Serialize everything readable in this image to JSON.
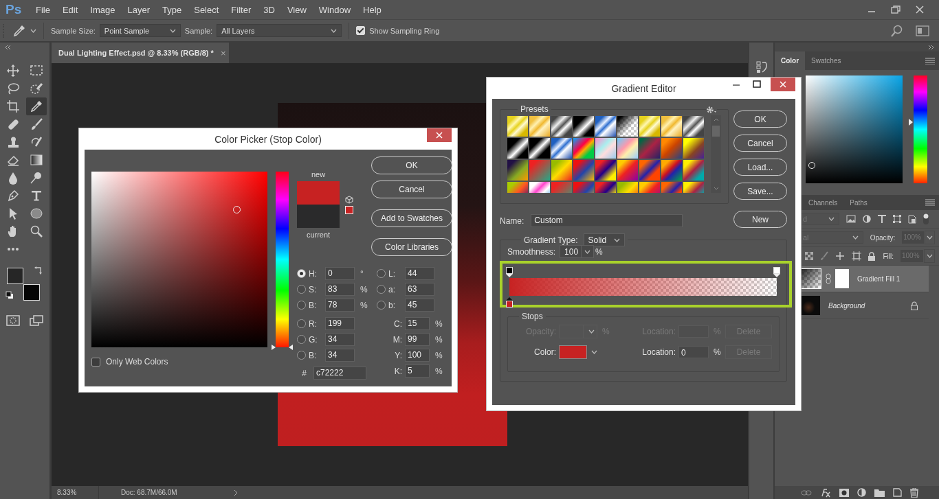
{
  "menu_bar": {
    "logo": "Ps",
    "items": [
      "File",
      "Edit",
      "Image",
      "Layer",
      "Type",
      "Select",
      "Filter",
      "3D",
      "View",
      "Window",
      "Help"
    ]
  },
  "options_bar": {
    "sample_size_label": "Sample Size:",
    "sample_size": "Point Sample",
    "sample_label": "Sample:",
    "sample": "All Layers",
    "sampling_ring": {
      "label": "Show Sampling Ring",
      "checked": true
    }
  },
  "tools": [
    {
      "kind": "move",
      "selected": false
    },
    {
      "kind": "marquee",
      "selected": false
    },
    {
      "kind": "lasso",
      "selected": false
    },
    {
      "kind": "quick-select",
      "selected": false
    },
    {
      "kind": "crop",
      "selected": false
    },
    {
      "kind": "eyedropper",
      "selected": true
    },
    {
      "kind": "healing",
      "selected": false
    },
    {
      "kind": "brush",
      "selected": false
    },
    {
      "kind": "stamp",
      "selected": false
    },
    {
      "kind": "history-brush",
      "selected": false
    },
    {
      "kind": "eraser",
      "selected": false
    },
    {
      "kind": "gradient",
      "selected": false
    },
    {
      "kind": "blur",
      "selected": false
    },
    {
      "kind": "dodge",
      "selected": false
    },
    {
      "kind": "pen",
      "selected": false
    },
    {
      "kind": "type",
      "selected": false
    },
    {
      "kind": "path-select",
      "selected": false
    },
    {
      "kind": "ellipse",
      "selected": false
    },
    {
      "kind": "hand",
      "selected": false
    },
    {
      "kind": "zoom",
      "selected": false
    },
    {
      "kind": "more",
      "selected": false
    }
  ],
  "color_swatches": [
    {
      "kind": "foreground",
      "color": "#262626"
    },
    {
      "kind": "background",
      "color": "#050505"
    }
  ],
  "view_tools": [
    {
      "kind": "quick-mask",
      "selected": false
    },
    {
      "kind": "screen-mode",
      "selected": false
    }
  ],
  "document": {
    "tab": "Dual Lighting Effect.psd @ 8.33% (RGB/8) *",
    "close": "×"
  },
  "status_bar": {
    "zoom": "8.33%",
    "doc_size": "Doc: 68.7M/66.0M"
  },
  "color_panel": {
    "tabs": [
      {
        "label": "Color",
        "selected": true
      },
      {
        "label": "Swatches",
        "selected": false
      }
    ],
    "hue_slider": {
      "level": 0.57
    }
  },
  "layers_panel": {
    "tabs": [
      {
        "label": "Channels",
        "selected": false
      },
      {
        "label": "Paths",
        "selected": false
      }
    ],
    "kind_filter": "d",
    "blend_mode": "al",
    "opacity_label": "Opacity:",
    "opacity": "100%",
    "fill_label": "Fill:",
    "fill": "100%",
    "controls_disabled": true,
    "layers": [
      {
        "kind": "fill",
        "name": "Gradient Fill 1",
        "selected": true,
        "locked": false
      },
      {
        "kind": "background",
        "name": "Background",
        "selected": false,
        "locked": true
      }
    ]
  },
  "gradient_editor": {
    "title": "Gradient Editor",
    "presets_label": "Presets",
    "buttons": [
      "OK",
      "Cancel",
      "Load...",
      "Save..."
    ],
    "new_button": "New",
    "name_label": "Name:",
    "name": "Custom",
    "type_label": "Gradient Type:",
    "type": "Solid",
    "smoothness_label": "Smoothness:",
    "smoothness": "100",
    "smoothness_unit": "%",
    "opacity_stops": [
      {
        "color": "#000000",
        "selected": false
      },
      {
        "color": "#ffffff",
        "selected": false
      }
    ],
    "color_stops": [
      {
        "color": "#c72222",
        "selected": true
      }
    ],
    "stops_label": "Stops",
    "stop_rows": [
      {
        "kind": "opacity",
        "label": "Opacity:",
        "unit": "%",
        "location_label": "Location:",
        "location_unit": "%",
        "delete": "Delete",
        "disabled": true
      },
      {
        "kind": "color",
        "label": "Color:",
        "color": "#c72222",
        "location_label": "Location:",
        "location": "0",
        "location_unit": "%",
        "delete": "Delete",
        "disabled": false
      }
    ]
  },
  "color_picker": {
    "title": "Color Picker (Stop Color)",
    "hue_slider": {
      "level": 0
    },
    "new_swatch": {
      "label": "new",
      "color": "#c72222"
    },
    "current_swatch": {
      "label": "current",
      "color": "#2a2a2b"
    },
    "buttons": [
      "OK",
      "Cancel",
      "Add to Swatches",
      "Color Libraries"
    ],
    "fields_left": [
      {
        "label": "H:",
        "value": "0",
        "unit": "°",
        "selected": true
      },
      {
        "label": "S:",
        "value": "83",
        "unit": "%",
        "selected": false
      },
      {
        "label": "B:",
        "value": "78",
        "unit": "%",
        "selected": false
      },
      {
        "label": "R:",
        "value": "199",
        "selected": false
      },
      {
        "label": "G:",
        "value": "34",
        "selected": false
      },
      {
        "label": "B:",
        "value": "34",
        "selected": false
      }
    ],
    "fields_right": [
      {
        "kind": "radio",
        "label": "L:",
        "value": "44",
        "selected": false
      },
      {
        "kind": "radio",
        "label": "a:",
        "value": "63",
        "selected": false
      },
      {
        "kind": "radio",
        "label": "b:",
        "value": "45",
        "selected": false
      },
      {
        "kind": "plain",
        "label": "C:",
        "value": "15",
        "unit": "%"
      },
      {
        "kind": "plain",
        "label": "M:",
        "value": "99",
        "unit": "%"
      },
      {
        "kind": "plain",
        "label": "Y:",
        "value": "100",
        "unit": "%"
      },
      {
        "kind": "plain",
        "label": "K:",
        "value": "5",
        "unit": "%"
      }
    ],
    "hex_label": "#",
    "hex": "c72222",
    "web_colors": {
      "label": "Only Web Colors",
      "checked": false
    }
  }
}
